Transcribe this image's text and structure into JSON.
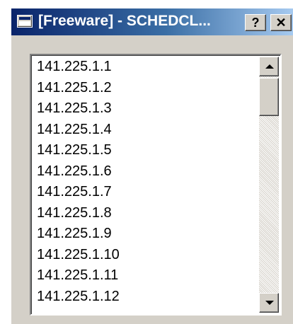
{
  "window": {
    "title": "[Freeware] - SCHEDCL...",
    "icon": "window-app-icon",
    "buttons": {
      "help_label": "?",
      "close_label": "✕"
    }
  },
  "list": {
    "items": [
      "141.225.1.1",
      "141.225.1.2",
      "141.225.1.3",
      "141.225.1.4",
      "141.225.1.5",
      "141.225.1.6",
      "141.225.1.7",
      "141.225.1.8",
      "141.225.1.9",
      "141.225.1.10",
      "141.225.1.11",
      "141.225.1.12"
    ]
  },
  "scrollbar": {
    "position": 0
  },
  "colors": {
    "titlebar_start": "#0a246a",
    "titlebar_end": "#a6caf0",
    "face": "#d4d0c8"
  }
}
